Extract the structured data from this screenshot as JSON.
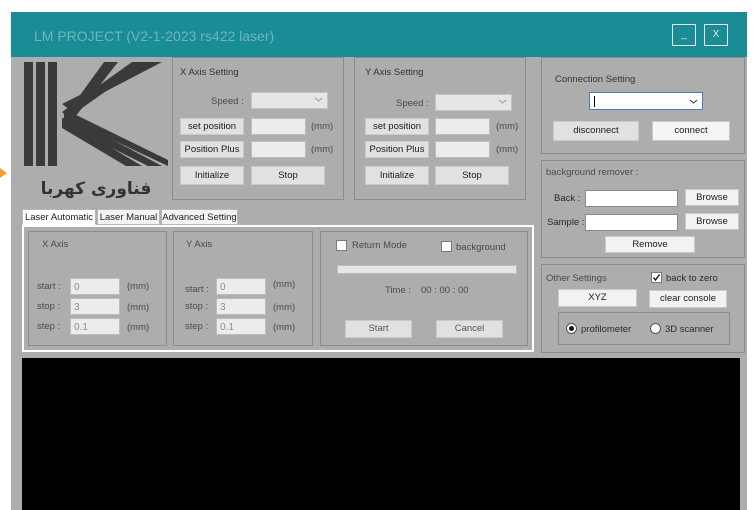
{
  "window": {
    "title": "LM PROJECT (V2-1-2023 rs422 laser)",
    "minimize_label": "_",
    "close_label": "X"
  },
  "logo": {
    "text": "فناوری کهربا"
  },
  "x_axis_setting": {
    "title": "X Axis Setting",
    "speed_label": "Speed :",
    "speed_value": "",
    "set_position_label": "set position",
    "set_position_value": "",
    "set_position_unit": "(mm)",
    "position_plus_label": "Position Plus",
    "position_plus_value": "",
    "position_plus_unit": "(mm)",
    "initialize_label": "Initialize",
    "stop_label": "Stop"
  },
  "y_axis_setting": {
    "title": "Y Axis Setting",
    "speed_label": "Speed :",
    "speed_value": "",
    "set_position_label": "set position",
    "set_position_value": "",
    "set_position_unit": "(mm)",
    "position_plus_label": "Position Plus",
    "position_plus_value": "",
    "position_plus_unit": "(mm)",
    "initialize_label": "Initialize",
    "stop_label": "Stop"
  },
  "connection": {
    "title": "Connection Setting",
    "port_value": "",
    "disconnect_label": "disconnect",
    "connect_label": "connect"
  },
  "background_remover": {
    "title": "background remover :",
    "back_label": "Back :",
    "back_value": "",
    "back_browse_label": "Browse",
    "sample_label": "Sample :",
    "sample_value": "",
    "sample_browse_label": "Browse",
    "remove_label": "Remove"
  },
  "tabs": [
    {
      "label": "Laser Automatic",
      "active": true
    },
    {
      "label": "Laser Manual",
      "active": false
    },
    {
      "label": "Advanced Setting",
      "active": false
    }
  ],
  "auto_x": {
    "title": "X Axis",
    "start_label": "start :",
    "start_value": "0",
    "start_unit": "(mm)",
    "stop_label": "stop :",
    "stop_value": "3",
    "stop_unit": "(mm)",
    "step_label": "step :",
    "step_value": "0.1",
    "step_unit": "(mm)"
  },
  "auto_y": {
    "title": "Y Axis",
    "start_label": "start :",
    "start_value": "0",
    "start_unit": "(mm)",
    "stop_label": "stop :",
    "stop_value": "3",
    "stop_unit": "(mm)",
    "step_label": "step :",
    "step_value": "0.1",
    "step_unit": "(mm)"
  },
  "auto_run": {
    "return_mode_label": "Return Mode",
    "return_mode_checked": false,
    "background_label": "background",
    "background_checked": false,
    "progress": 0,
    "time_label": "Time :",
    "time_value": "00 : 00 : 00",
    "start_label": "Start",
    "cancel_label": "Cancel"
  },
  "other_settings": {
    "title": "Other Settings",
    "back_to_zero_label": "back to zero",
    "back_to_zero_checked": true,
    "xyz_label": "XYZ",
    "clear_console_label": "clear console",
    "profilometer_label": "profilometer",
    "profilometer_selected": true,
    "scanner_label": "3D scanner",
    "scanner_selected": false
  },
  "colors": {
    "title_bar": "#1a8c96",
    "window_bg": "#adadad",
    "console_bg": "#000000",
    "accent_orange": "#f0a030"
  }
}
